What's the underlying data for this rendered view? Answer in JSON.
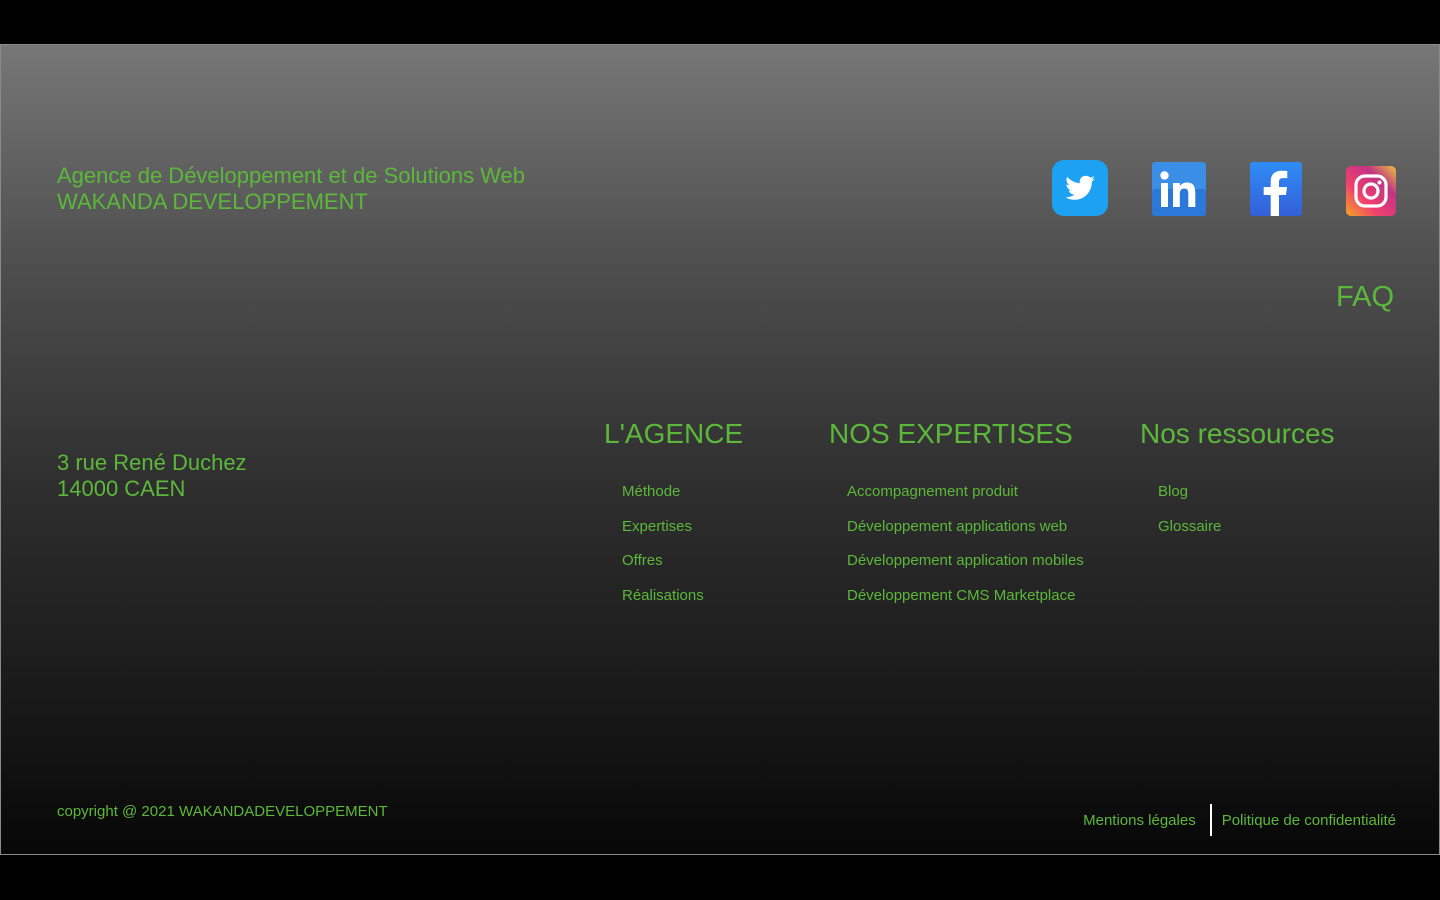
{
  "brand": {
    "line1": "Agence de Développement et de Solutions Web",
    "line2": "WAKANDA DEVELOPPEMENT"
  },
  "social": [
    {
      "icon": "twitter-icon",
      "color": "#1da1f2"
    },
    {
      "icon": "linkedin-icon",
      "color": "#2b7fe0"
    },
    {
      "icon": "facebook-icon",
      "color": "#1877f2"
    },
    {
      "icon": "instagram-icon",
      "color": "#e1306c"
    }
  ],
  "faq": "FAQ",
  "address": {
    "street": "3 rue René Duchez",
    "city": "14000 CAEN"
  },
  "columns": {
    "agence": {
      "title": "L'AGENCE",
      "items": [
        "Méthode",
        "Expertises",
        "Offres",
        "Réalisations"
      ]
    },
    "expertises": {
      "title": "NOS EXPERTISES",
      "items": [
        "Accompagnement produit",
        "Développement applications web",
        "Développement application mobiles",
        "Développement CMS Marketplace"
      ]
    },
    "ressources": {
      "title": "Nos ressources",
      "items": [
        "Blog",
        "Glossaire"
      ]
    }
  },
  "copyright": "copyright @ 2021 WAKANDADEVELOPPEMENT",
  "legal": {
    "mentions": "Mentions légales",
    "privacy": "Politique de confidentialité"
  },
  "colors": {
    "accent": "#5cb83a",
    "separator": "#ffffff"
  }
}
